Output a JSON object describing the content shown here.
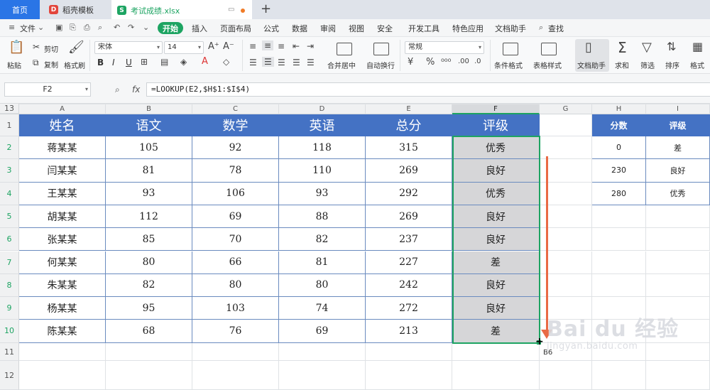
{
  "titlebar": {
    "home_tab": "首页",
    "template_tab": "稻壳模板",
    "doc_tab": "考试成绩.xlsx",
    "template_logo": "D",
    "doc_logo": "S",
    "new_tab": "+"
  },
  "menubar": {
    "file": "文件",
    "start": "开始",
    "items": [
      "插入",
      "页面布局",
      "公式",
      "数据",
      "审阅",
      "视图",
      "安全",
      "开发工具",
      "特色应用",
      "文档助手"
    ],
    "search": "查找"
  },
  "toolbar": {
    "paste": "粘贴",
    "cut": "剪切",
    "copy": "复制",
    "format_painter": "格式刷",
    "font_name": "宋体",
    "font_size": "14",
    "bold": "B",
    "italic": "I",
    "underline": "U",
    "number_format": "常规",
    "merge_center": "合并居中",
    "auto_wrap": "自动换行",
    "cond_format": "条件格式",
    "table_style": "表格样式",
    "doc_assistant": "文档助手",
    "sum": "求和",
    "filter": "筛选",
    "sort": "排序",
    "format": "格式"
  },
  "formula_bar": {
    "cell_ref": "F2",
    "fx": "fx",
    "formula": "=LOOKUP(E2,$H$1:$I$4)"
  },
  "sheet": {
    "columns": [
      "A",
      "B",
      "C",
      "D",
      "E",
      "F",
      "G",
      "H",
      "I"
    ],
    "rows": [
      "1",
      "2",
      "3",
      "4",
      "5",
      "6",
      "7",
      "8",
      "9",
      "10",
      "11",
      "12",
      "13"
    ],
    "headers": [
      "姓名",
      "语文",
      "数学",
      "英语",
      "总分",
      "评级"
    ],
    "data": [
      [
        "蒋某某",
        "105",
        "92",
        "118",
        "315",
        "优秀"
      ],
      [
        "闫某某",
        "81",
        "78",
        "110",
        "269",
        "良好"
      ],
      [
        "王某某",
        "93",
        "106",
        "93",
        "292",
        "优秀"
      ],
      [
        "胡某某",
        "112",
        "69",
        "88",
        "269",
        "良好"
      ],
      [
        "张某某",
        "85",
        "70",
        "82",
        "237",
        "良好"
      ],
      [
        "何某某",
        "80",
        "66",
        "81",
        "227",
        "差"
      ],
      [
        "朱某某",
        "82",
        "80",
        "80",
        "242",
        "良好"
      ],
      [
        "杨某某",
        "95",
        "103",
        "74",
        "272",
        "良好"
      ],
      [
        "陈某某",
        "68",
        "76",
        "69",
        "213",
        "差"
      ]
    ],
    "lookup_headers": [
      "分数",
      "评级"
    ],
    "lookup": [
      [
        "0",
        "差"
      ],
      [
        "230",
        "良好"
      ],
      [
        "280",
        "优秀"
      ]
    ]
  },
  "overlay": {
    "tooltip": "B6",
    "watermark_main": "Bai du 经验",
    "watermark_sub": "jingyan.baidu.com",
    "arrow_color": "#e96a45",
    "selection_color": "#1da462"
  },
  "colors": {
    "header_blue": "#4472c4",
    "wps_green": "#1da462",
    "home_blue": "#2a75e6"
  }
}
